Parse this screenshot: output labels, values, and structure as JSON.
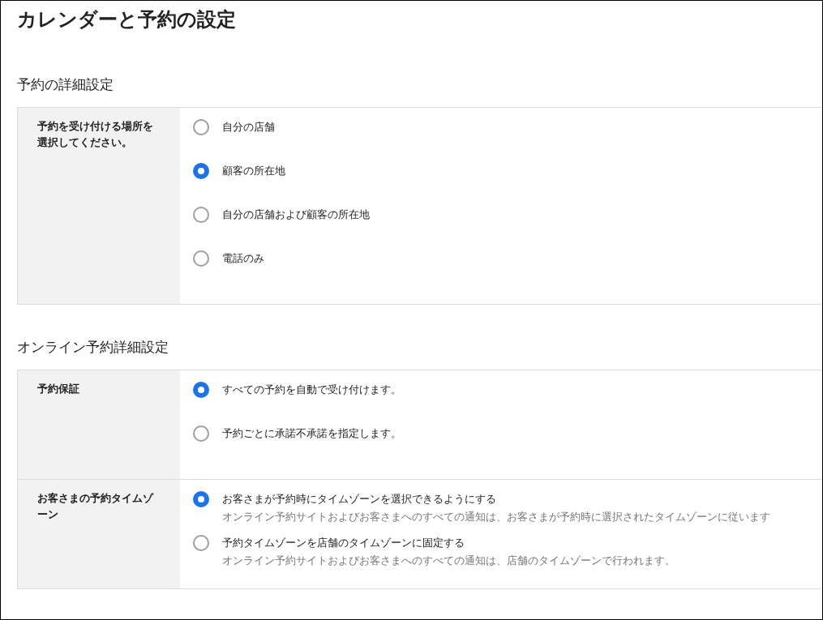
{
  "title": "カレンダーと予約の設定",
  "sections": [
    {
      "heading": "予約の詳細設定",
      "rows": [
        {
          "label": "予約を受け付ける場所を選択してください。",
          "options": [
            {
              "label": "自分の店舗",
              "selected": false
            },
            {
              "label": "顧客の所在地",
              "selected": true
            },
            {
              "label": "自分の店舗および顧客の所在地",
              "selected": false
            },
            {
              "label": "電話のみ",
              "selected": false
            }
          ]
        }
      ]
    },
    {
      "heading": "オンライン予約詳細設定",
      "rows": [
        {
          "label": "予約保証",
          "options": [
            {
              "label": "すべての予約を自動で受け付けます。",
              "selected": true
            },
            {
              "label": "予約ごとに承諾不承諾を指定します。",
              "selected": false
            }
          ]
        },
        {
          "label": "お客さまの予約タイムゾーン",
          "options": [
            {
              "label": "お客さまが予約時にタイムゾーンを選択できるようにする",
              "description": "オンライン予約サイトおよびお客さまへのすべての通知は、お客さまが予約時に選択されたタイムゾーンに従います",
              "selected": true
            },
            {
              "label": "予約タイムゾーンを店舗のタイムゾーンに固定する",
              "description": "オンライン予約サイトおよびお客さまへのすべての通知は、店舗のタイムゾーンで行われます。",
              "selected": false
            }
          ]
        }
      ]
    }
  ]
}
